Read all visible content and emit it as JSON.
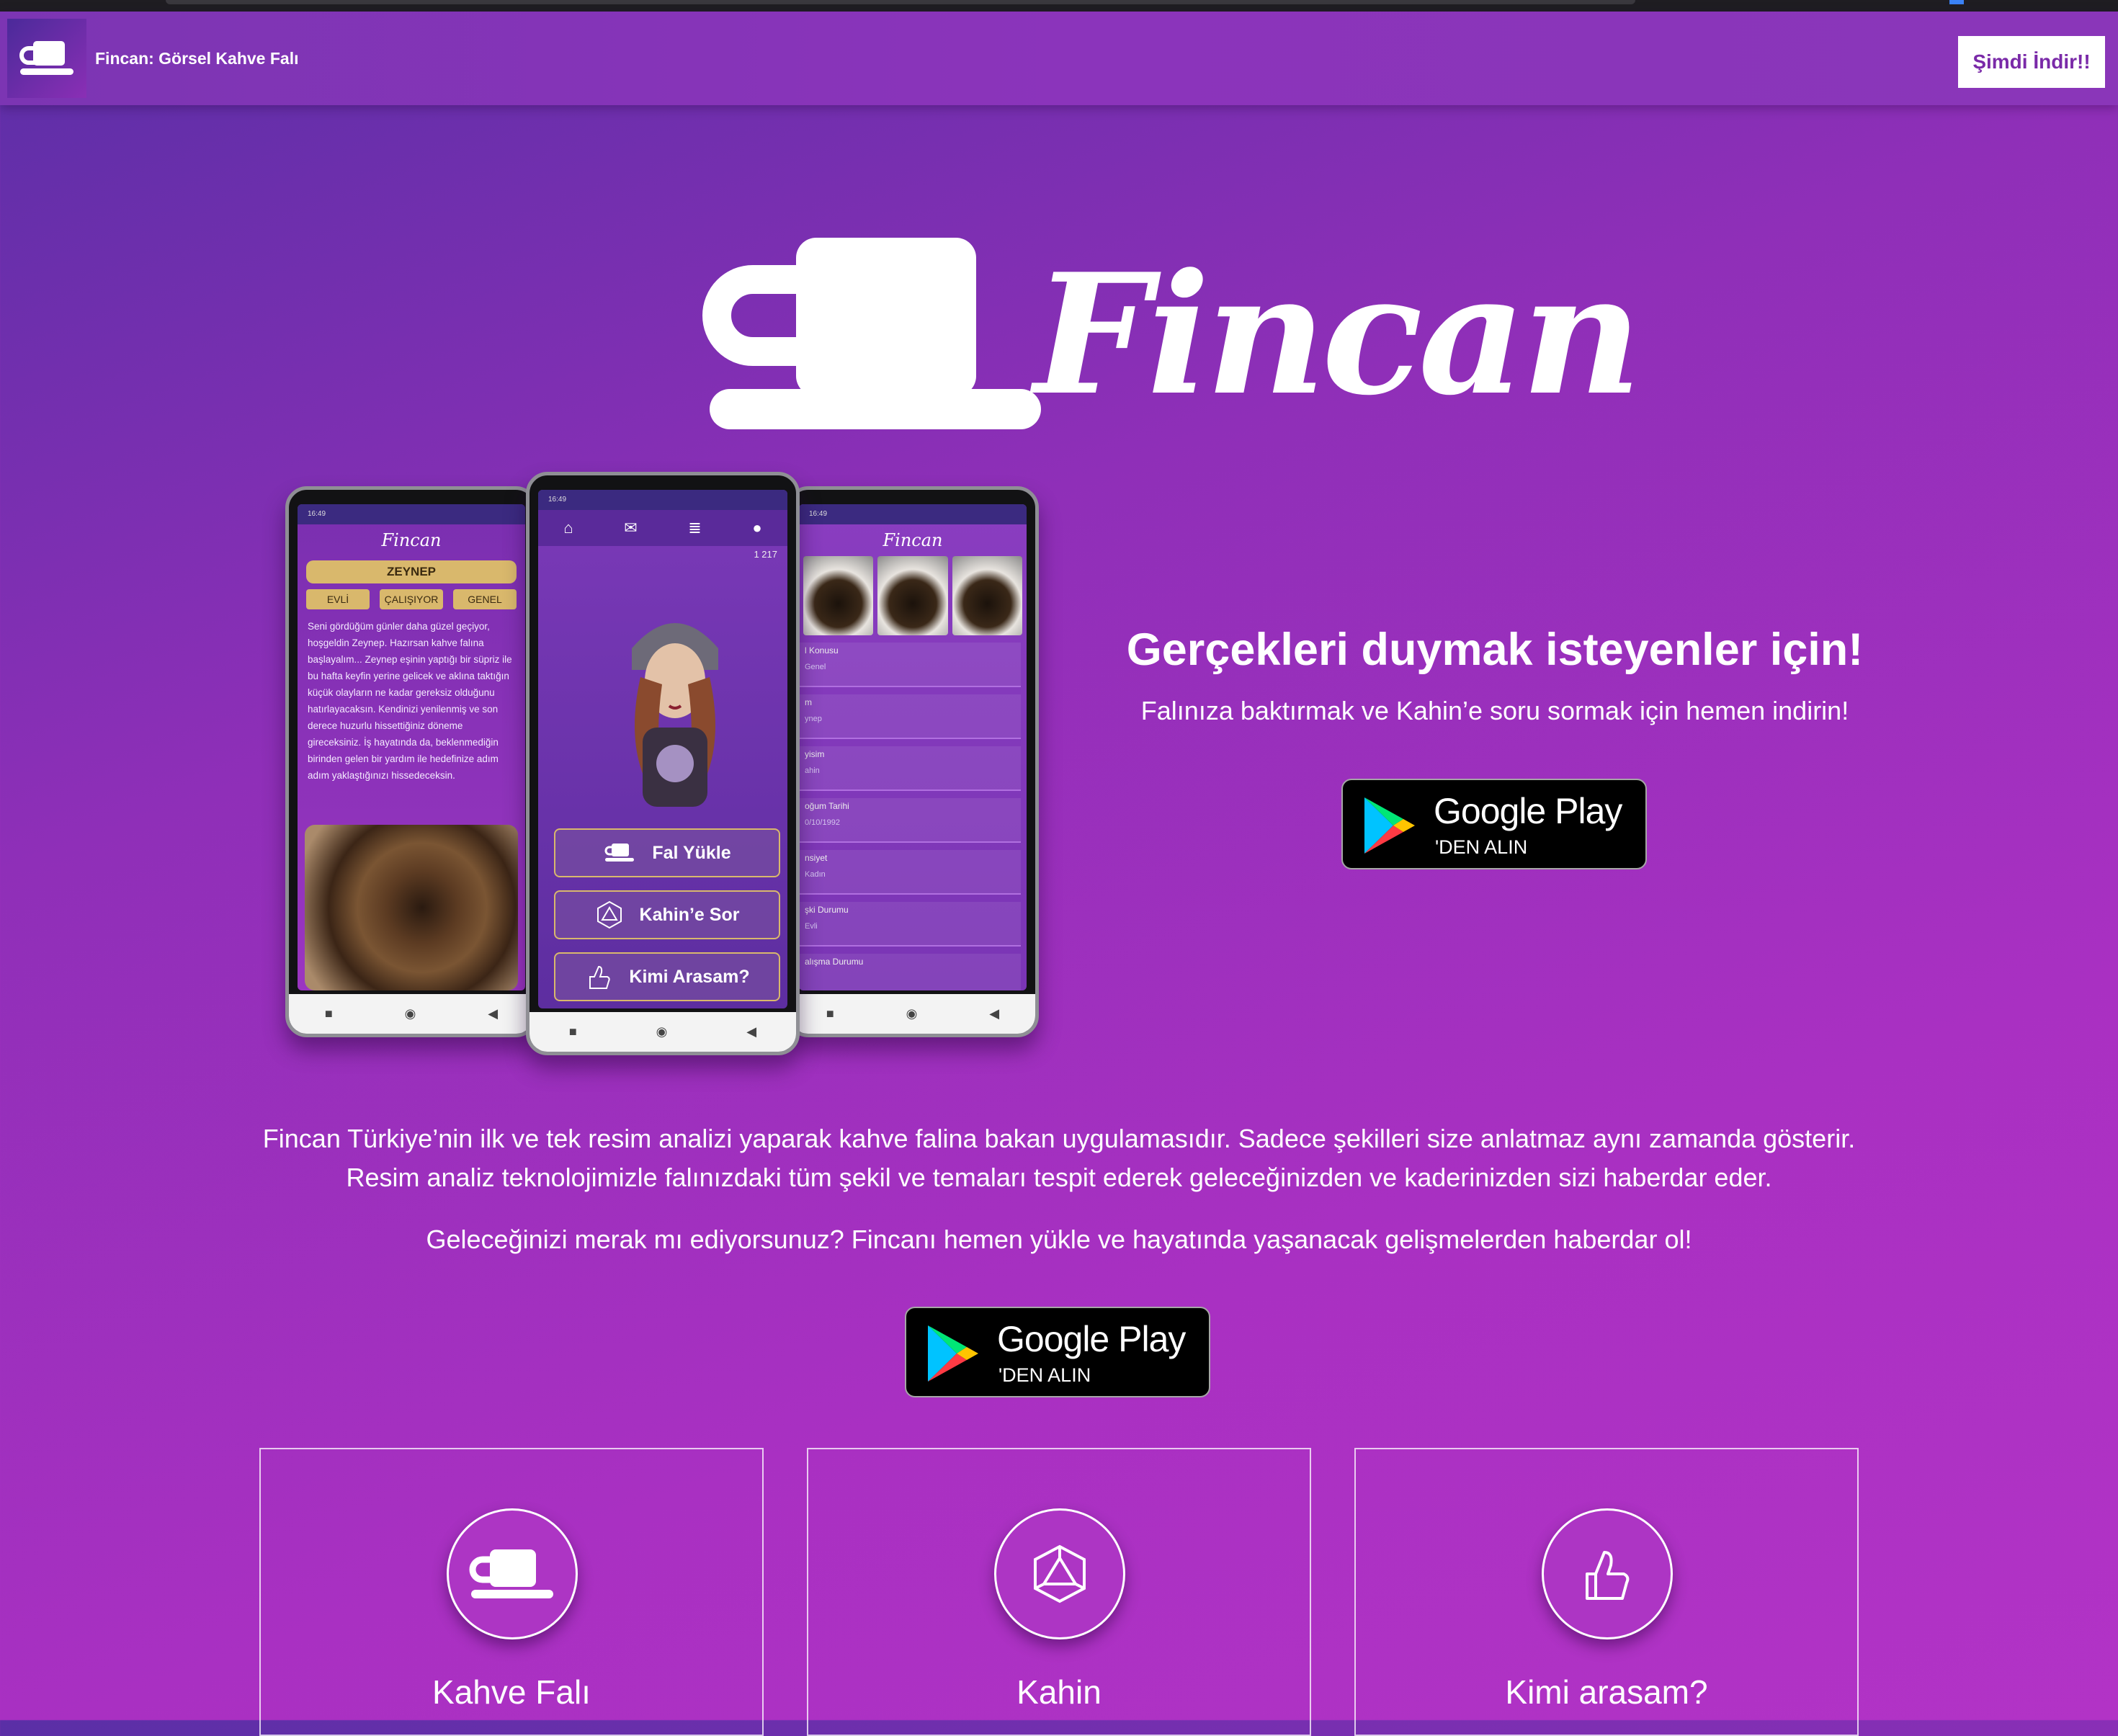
{
  "nav": {
    "title": "Fincan: Görsel Kahve Falı",
    "download_label": "Şimdi İndir!!"
  },
  "hero": {
    "brand": "Fincan",
    "heading": "Gerçekleri duymak isteyenler için!",
    "subheading": "Falınıza baktırmak ve Kahin’e soru sormak için hemen indirin!"
  },
  "badge": {
    "main": "Google Play",
    "sub": "'DEN ALIN"
  },
  "phones": {
    "left": {
      "logo": "Fincan",
      "name": "ZEYNEP",
      "chips": [
        "EVLİ",
        "ÇALIŞIYOR",
        "GENEL"
      ],
      "reading": "Seni gördüğüm günler daha güzel geçiyor, hoşgeldin Zeynep. Hazırsan kahve falına başlayalım... Zeynep eşinin yaptığı bir süpriz ile bu hafta keyfin yerine gelicek ve aklına taktığın küçük olayların ne kadar gereksiz olduğunu hatırlayacaksın. Kendinizi yenilenmiş ve son derece huzurlu hissettiğiniz döneme gireceksiniz. İş hayatında da, beklenmediğin birinden gelen bir yardım ile hedefinize adım adım yaklaştığınızı hissedeceksin."
    },
    "center": {
      "counter": "1   217",
      "buttons": [
        "Fal Yükle",
        "Kahin’e Sor",
        "Kimi Arasam?"
      ]
    },
    "right": {
      "logo": "Fincan",
      "fields": [
        {
          "label": "l Konusu",
          "value": "Genel"
        },
        {
          "label": "m",
          "value": "ynep"
        },
        {
          "label": "yisim",
          "value": "ahin"
        },
        {
          "label": "oğum Tarihi",
          "value": "0/10/1992"
        },
        {
          "label": "nsiyet",
          "value": "Kadın"
        },
        {
          "label": "şki Durumu",
          "value": "Evli"
        },
        {
          "label": "alışma Durumu",
          "value": ""
        }
      ]
    }
  },
  "description": {
    "line1": "Fincan Türkiye’nin ilk ve tek resim analizi yaparak kahve falina bakan uygulamasıdır. Sadece şekilleri size anlatmaz aynı zamanda gösterir.",
    "line2": "Resim analiz teknolojimizle falınızdaki tüm şekil ve temaları tespit ederek geleceğinizden ve kaderinizden sizi haberdar eder.",
    "line3": "Geleceğinizi merak mı ediyorsunuz? Fincanı hemen yükle ve hayatında yaşanacak gelişmelerden haberdar ol!"
  },
  "features": [
    {
      "title": "Kahve Falı",
      "icon": "coffee-cup-icon"
    },
    {
      "title": "Kahin",
      "icon": "icosahedron-icon"
    },
    {
      "title": "Kimi arasam?",
      "icon": "thumbs-up-icon"
    }
  ],
  "colors": {
    "accent": "#7a2aa8",
    "gold": "#d9b86c",
    "bg_start": "#5a2fa6",
    "bg_end": "#b233c6"
  }
}
